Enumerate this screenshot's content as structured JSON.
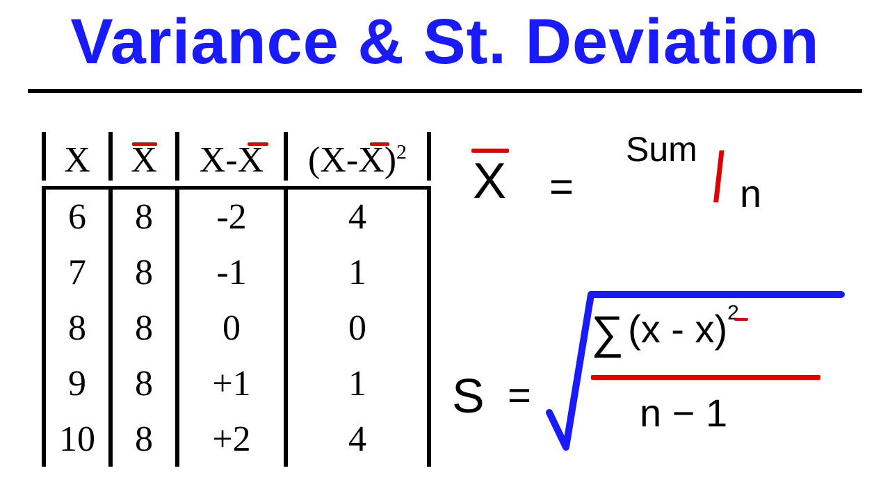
{
  "title": "Variance & St. Deviation",
  "table": {
    "headers": {
      "c1": "X",
      "c2": "X",
      "c3": "X-X",
      "c4": "(X-X)"
    },
    "header_sup": "2",
    "rows": [
      {
        "x": "6",
        "xbar": "8",
        "diff": "-2",
        "sq": "4"
      },
      {
        "x": "7",
        "xbar": "8",
        "diff": "-1",
        "sq": "1"
      },
      {
        "x": "8",
        "xbar": "8",
        "diff": "0",
        "sq": "0"
      },
      {
        "x": "9",
        "xbar": "8",
        "diff": "+1",
        "sq": "1"
      },
      {
        "x": "10",
        "xbar": "8",
        "diff": "+2",
        "sq": "4"
      }
    ]
  },
  "formulas": {
    "mean": {
      "lhs": "X",
      "eq": "=",
      "num": "Sum",
      "den": "n"
    },
    "sd": {
      "lhs": "S",
      "eq": "=",
      "sigma": "∑",
      "body": "(x - x)",
      "exp": "2",
      "den": "n − 1"
    }
  },
  "colors": {
    "title": "#1a1aff",
    "bar": "#e00000",
    "radical": "#1a1aff"
  }
}
